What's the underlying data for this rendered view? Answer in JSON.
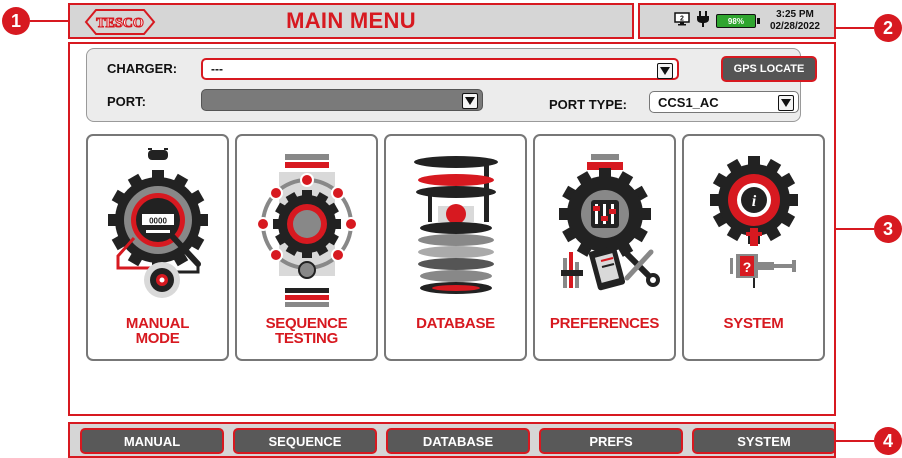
{
  "app": {
    "title": "MAIN MENU",
    "logo_text": "TESCO"
  },
  "status": {
    "battery_percent": "98%",
    "time": "3:25 PM",
    "date": "02/28/2022",
    "screen_badge": "2",
    "icons": [
      "screen-icon",
      "power-plug-icon",
      "battery-icon"
    ]
  },
  "settings": {
    "charger_label": "CHARGER:",
    "charger_value": "---",
    "port_label": "PORT:",
    "port_value": "",
    "port_type_label": "PORT TYPE:",
    "port_type_value": "CCS1_AC",
    "gps_button": "GPS LOCATE"
  },
  "tiles": [
    {
      "label_line1": "MANUAL",
      "label_line2": "MODE",
      "icon": "manual-mode-icon"
    },
    {
      "label_line1": "SEQUENCE",
      "label_line2": "TESTING",
      "icon": "sequence-testing-icon"
    },
    {
      "label_line1": "DATABASE",
      "label_line2": "",
      "icon": "database-icon"
    },
    {
      "label_line1": "PREFERENCES",
      "label_line2": "",
      "icon": "preferences-icon"
    },
    {
      "label_line1": "SYSTEM",
      "label_line2": "",
      "icon": "system-icon"
    }
  ],
  "nav": [
    "MANUAL",
    "SEQUENCE",
    "DATABASE",
    "PREFS",
    "SYSTEM"
  ],
  "callouts": [
    "1",
    "2",
    "3",
    "4"
  ],
  "colors": {
    "accent_red": "#d71920",
    "bar_gray": "#d6d6d6",
    "button_gray": "#595959",
    "battery_green": "#2fa52f"
  }
}
